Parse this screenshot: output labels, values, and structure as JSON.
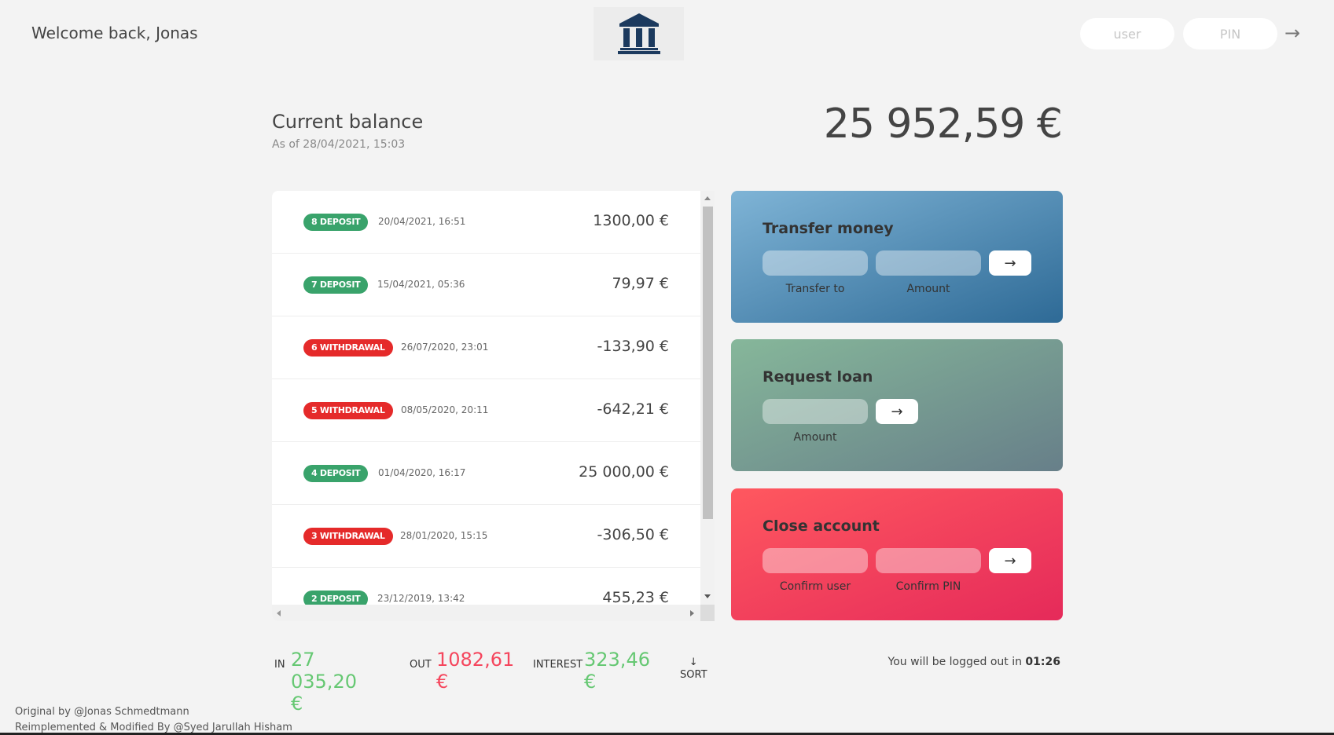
{
  "nav": {
    "welcome": "Welcome back, Jonas",
    "logo_icon": "bank-building-icon",
    "user_placeholder": "user",
    "pin_placeholder": "PIN",
    "login_arrow": "→"
  },
  "balance": {
    "label": "Current balance",
    "date": "As of 28/04/2021, 15:03",
    "value": "25 952,59 €"
  },
  "movements": [
    {
      "type": "8 deposit",
      "kind": "deposit",
      "date": "20/04/2021, 16:51",
      "value": "1300,00 €"
    },
    {
      "type": "7 deposit",
      "kind": "deposit",
      "date": "15/04/2021, 05:36",
      "value": "79,97 €"
    },
    {
      "type": "6 withdrawal",
      "kind": "withdrawal",
      "date": "26/07/2020, 23:01",
      "value": "-133,90 €"
    },
    {
      "type": "5 withdrawal",
      "kind": "withdrawal",
      "date": "08/05/2020, 20:11",
      "value": "-642,21 €"
    },
    {
      "type": "4 deposit",
      "kind": "deposit",
      "date": "01/04/2020, 16:17",
      "value": "25 000,00 €"
    },
    {
      "type": "3 withdrawal",
      "kind": "withdrawal",
      "date": "28/01/2020, 15:15",
      "value": "-306,50 €"
    },
    {
      "type": "2 deposit",
      "kind": "deposit",
      "date": "23/12/2019, 13:42",
      "value": "455,23 €"
    }
  ],
  "colors": {
    "deposit": "#39a36b",
    "withdrawal": "#e52a2a",
    "positive": "#66c873",
    "negative": "#f5465d"
  },
  "operations": {
    "transfer": {
      "title": "Transfer money",
      "label1": "Transfer to",
      "label2": "Amount",
      "button": "→"
    },
    "loan": {
      "title": "Request loan",
      "label1": "Amount",
      "button": "→"
    },
    "close": {
      "title": "Close account",
      "label1": "Confirm user",
      "label2": "Confirm PIN",
      "button": "→"
    }
  },
  "summary": {
    "in_label": "In",
    "in_value": "27 035,20 €",
    "out_label": "Out",
    "out_value": "1082,61 €",
    "interest_label": "Interest",
    "interest_value": "323,46 €",
    "sort_arrow": "↓",
    "sort_label": "SORT"
  },
  "logout": {
    "text": "You will be logged out in ",
    "timer": "01:26"
  },
  "footer": {
    "line1": "Original by @Jonas Schmedtmann",
    "line2": "Reimplemented & Modified By @Syed Jarullah Hisham"
  }
}
